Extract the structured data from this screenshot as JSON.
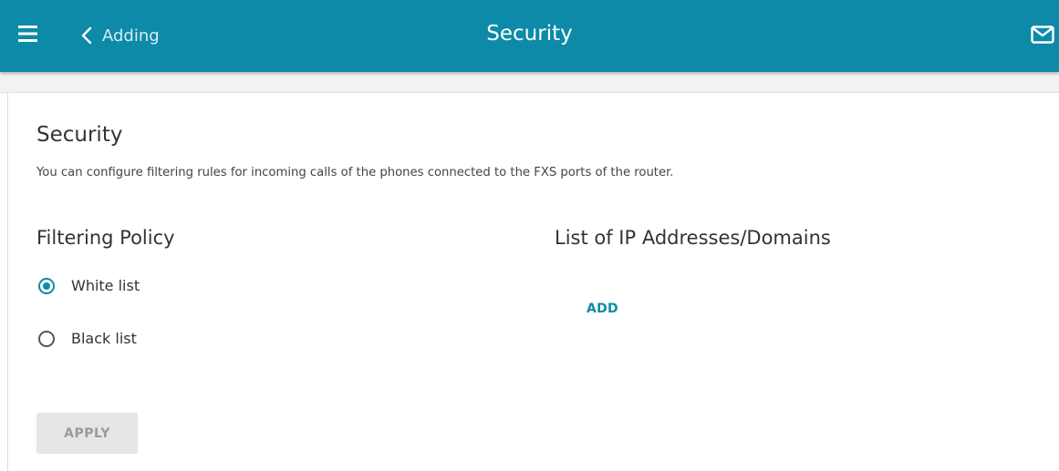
{
  "header": {
    "back_label": "Adding",
    "title": "Security",
    "background_color": "#0d8aa7",
    "menu_icon": "hamburger-menu-icon",
    "back_icon": "chevron-left-icon",
    "notifications_icon": "mail-icon"
  },
  "main": {
    "section_title": "Security",
    "description": "You can configure filtering rules for incoming calls of the phones connected to the FXS ports of the router.",
    "filtering_policy": {
      "title": "Filtering Policy",
      "options": [
        {
          "label": "White list",
          "selected": true
        },
        {
          "label": "Black list",
          "selected": false
        }
      ]
    },
    "ip_list": {
      "title": "List of IP Addresses/Domains",
      "add_label": "ADD"
    },
    "apply_label": "APPLY"
  }
}
